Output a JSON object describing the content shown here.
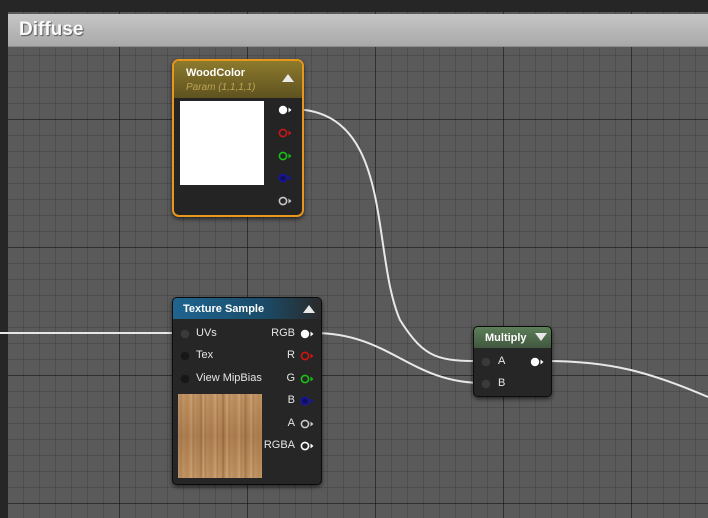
{
  "comment": {
    "title": "Diffuse"
  },
  "nodes": {
    "wood_color": {
      "title": "WoodColor",
      "subtitle": "Param (1,1,1,1)",
      "preview_color": "#ffffff",
      "outputs": [
        "rgba",
        "r",
        "g",
        "b",
        "a"
      ]
    },
    "texture_sample": {
      "title": "Texture Sample",
      "inputs": [
        {
          "label": "UVs"
        },
        {
          "label": "Tex"
        },
        {
          "label": "View MipBias"
        }
      ],
      "outputs": [
        {
          "label": "RGB",
          "color": "#ffffff"
        },
        {
          "label": "R",
          "color": "#d01515"
        },
        {
          "label": "G",
          "color": "#18c018"
        },
        {
          "label": "B",
          "color": "#1515a8"
        },
        {
          "label": "A",
          "color": "#c8c8c8"
        },
        {
          "label": "RGBA",
          "color": "#ffffff"
        }
      ],
      "preview_texture": "wood-texture"
    },
    "multiply": {
      "title": "Multiply",
      "inputs": [
        {
          "label": "A"
        },
        {
          "label": "B"
        }
      ],
      "outputs": [
        {
          "label": "",
          "color": "#ffffff"
        }
      ]
    }
  },
  "colors": {
    "param_header": "#7a6a24",
    "param_outline": "#e8961c",
    "texture_header": "#1e5f86",
    "math_header": "#4e6e4c",
    "wire": "#e8e8e8",
    "pin_white": "#ffffff",
    "pin_red": "#d01515",
    "pin_green": "#18c018",
    "pin_blue": "#1515a8",
    "pin_alpha": "#c8c8c8"
  }
}
